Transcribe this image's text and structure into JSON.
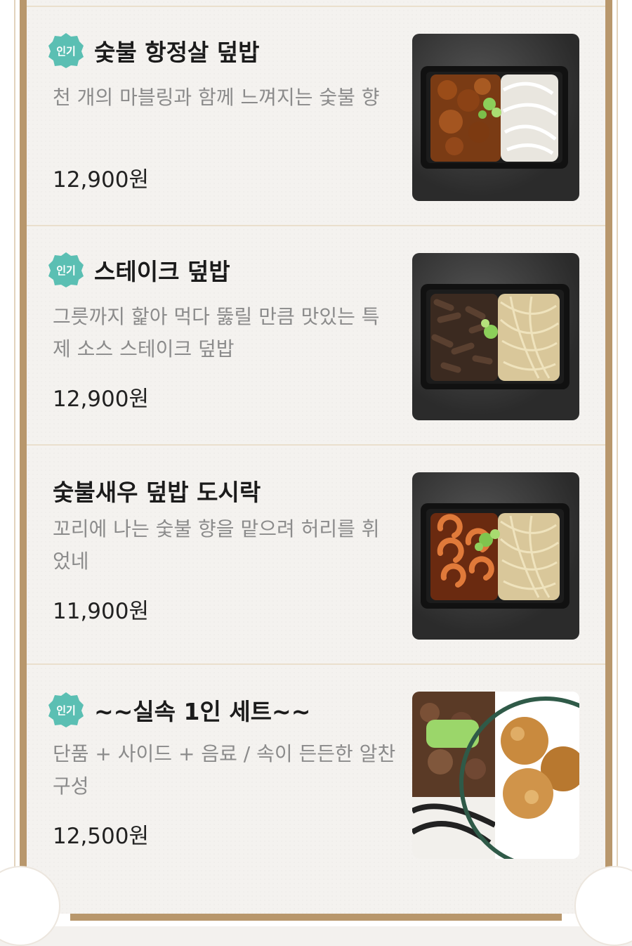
{
  "menu": {
    "items": [
      {
        "badge": "인기",
        "name": "숯불 항정살 덮밥",
        "description": "천 개의 마블링과 함께 느껴지는 숯불 향",
        "price": "12,900원",
        "photo_icon": "pork-rice-bowl-photo"
      },
      {
        "badge": "인기",
        "name": "스테이크 덮밥",
        "description": "그릇까지 핥아 먹다 뚫릴 만큼 맛있는 특제 소스 스테이크 덮밥",
        "price": "12,900원",
        "photo_icon": "steak-rice-bowl-photo"
      },
      {
        "name": "숯불새우 덮밥 도시락",
        "description": "꼬리에 나는 숯불 향을 맡으려 허리를 휘었네",
        "price": "11,900원",
        "photo_icon": "shrimp-rice-bowl-photo"
      },
      {
        "badge": "인기",
        "name": "~~실속 1인 세트~~",
        "description": "단품 + 사이드 + 음료 / 속이 든든한 알찬 구성",
        "price": "12,500원",
        "photo_icon": "set-meal-photo"
      }
    ]
  },
  "colors": {
    "badge": "#5bbfb3",
    "frame": "#b8976c",
    "divider": "#eadfcd"
  }
}
